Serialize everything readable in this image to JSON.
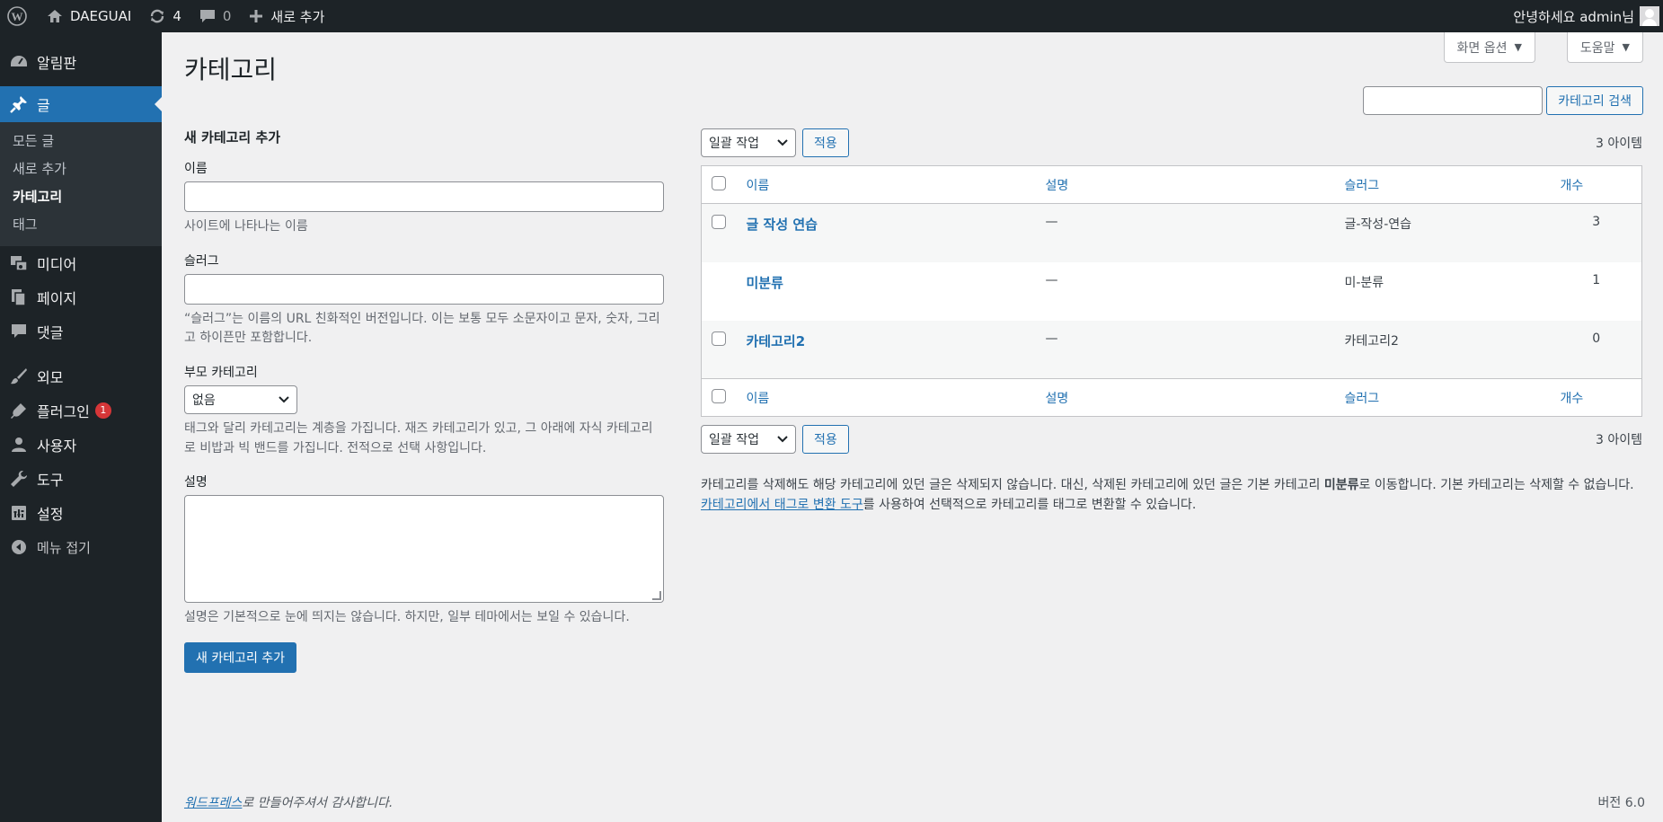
{
  "adminbar": {
    "site_name": "DAEGUAI",
    "updates_count": "4",
    "comments_count": "0",
    "new_label": "새로 추가",
    "greeting": "안녕하세요 admin님"
  },
  "sidebar": {
    "items": [
      {
        "label": "알림판",
        "icon": "dashboard-icon"
      },
      {
        "label": "글",
        "icon": "pin-icon"
      },
      {
        "label": "미디어",
        "icon": "media-icon"
      },
      {
        "label": "페이지",
        "icon": "pages-icon"
      },
      {
        "label": "댓글",
        "icon": "comment-icon"
      },
      {
        "label": "외모",
        "icon": "brush-icon"
      },
      {
        "label": "플러그인",
        "icon": "plugin-icon",
        "badge": "1"
      },
      {
        "label": "사용자",
        "icon": "user-icon"
      },
      {
        "label": "도구",
        "icon": "wrench-icon"
      },
      {
        "label": "설정",
        "icon": "settings-icon"
      },
      {
        "label": "메뉴 접기",
        "icon": "collapse-icon"
      }
    ],
    "submenu": [
      "모든 글",
      "새로 추가",
      "카테고리",
      "태그"
    ]
  },
  "screen_meta": {
    "screen_options": "화면 옵션",
    "help": "도움말"
  },
  "page": {
    "title": "카테고리",
    "search_button": "카테고리 검색"
  },
  "form": {
    "heading": "새 카테고리 추가",
    "name_label": "이름",
    "name_help": "사이트에 나타나는 이름",
    "slug_label": "슬러그",
    "slug_help": "“슬러그”는 이름의 URL 친화적인 버전입니다. 이는 보통 모두 소문자이고 문자, 숫자, 그리고 하이픈만 포함합니다.",
    "parent_label": "부모 카테고리",
    "parent_value": "없음",
    "parent_help": "태그와 달리 카테고리는 계층을 가집니다. 재즈 카테고리가 있고, 그 아래에 자식 카테고리로 비밥과 빅 밴드를 가집니다. 전적으로 선택 사항입니다.",
    "desc_label": "설명",
    "desc_help": "설명은 기본적으로 눈에 띄지는 않습니다. 하지만, 일부 테마에서는 보일 수 있습니다.",
    "submit": "새 카테고리 추가"
  },
  "table": {
    "bulk_label": "일괄 작업",
    "apply_label": "적용",
    "items_count": "3 아이템",
    "columns": {
      "name": "이름",
      "description": "설명",
      "slug": "슬러그",
      "count": "개수"
    },
    "rows": [
      {
        "name": "글 작성 연습",
        "description": "—",
        "slug": "글-작성-연습",
        "count": "3"
      },
      {
        "name": "미분류",
        "description": "—",
        "slug": "미-분류",
        "count": "1"
      },
      {
        "name": "카테고리2",
        "description": "—",
        "slug": "카테고리2",
        "count": "0"
      }
    ]
  },
  "notes": {
    "line1_pre": "카테고리를 삭제해도 해당 카테고리에 있던 글은 삭제되지 않습니다. 대신, 삭제된 카테고리에 있던 글은 기본 카테고리 ",
    "line1_bold": "미분류",
    "line1_post": "로 이동합니다. 기본 카테고리는 삭제할 수 없습니다.",
    "link": "카테고리에서 태그로 변환 도구",
    "line2_post": "를 사용하여 선택적으로 카테고리를 태그로 변환할 수 있습니다."
  },
  "footer": {
    "link": "워드프레스",
    "thanks_post": "로 만들어주셔서 감사합니다.",
    "version": "버전 6.0"
  }
}
